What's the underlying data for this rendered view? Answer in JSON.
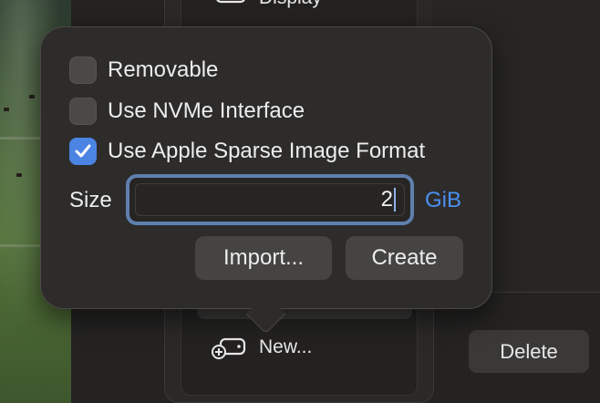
{
  "sidebar": {
    "display_label": "Display",
    "new_label": "New...",
    "display_icon": "display-icon",
    "new_icon": "add-disk-icon"
  },
  "popover": {
    "options": [
      {
        "label": "Removable",
        "checked": false
      },
      {
        "label": "Use NVMe Interface",
        "checked": false
      },
      {
        "label": "Use Apple Sparse Image Format",
        "checked": true
      }
    ],
    "size_label": "Size",
    "size_value": "2",
    "size_unit": "GiB",
    "import_label": "Import...",
    "create_label": "Create"
  },
  "actions": {
    "delete_label": "Delete"
  },
  "colors": {
    "accent": "#4b84e3",
    "unit_link": "#4c8ff0",
    "focus_ring": "#5f7fae"
  }
}
